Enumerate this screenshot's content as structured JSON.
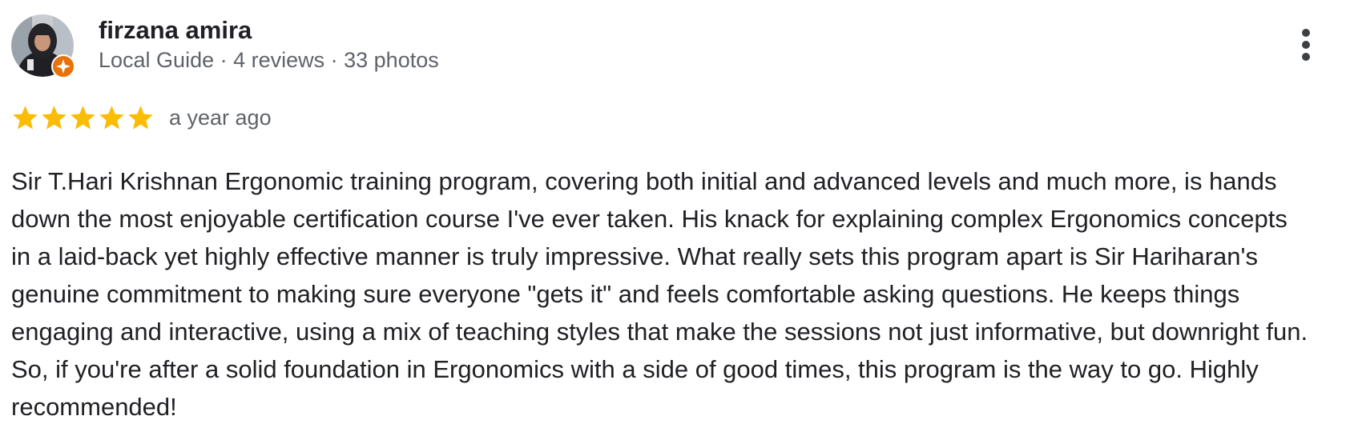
{
  "reviewer": {
    "name": "firzana amira",
    "meta": "Local Guide · 4 reviews · 33 photos",
    "avatar_icon": "user-avatar-photo",
    "badge_icon": "local-guide-badge-icon"
  },
  "review": {
    "rating": 5,
    "rating_max": 5,
    "time": "a year ago",
    "text": "Sir T.Hari Krishnan Ergonomic training program, covering both initial and advanced levels and much more, is hands down the most enjoyable certification course I've ever taken. His knack for explaining complex Ergonomics concepts in a laid-back yet highly effective manner is truly impressive. What really sets this program apart is Sir Hariharan's genuine commitment to making sure everyone \"gets it\" and feels comfortable asking questions. He keeps things engaging and interactive, using a mix of teaching styles that make the sessions not just informative, but downright fun. So, if you're after a solid foundation in Ergonomics with a side of good times, this program is the way to go. Highly recommended!"
  },
  "menu": {
    "icon": "more-vert-icon"
  },
  "colors": {
    "star": "#fbbc04",
    "badge": "#e8710a",
    "name": "#202124",
    "meta": "#5f6368"
  }
}
